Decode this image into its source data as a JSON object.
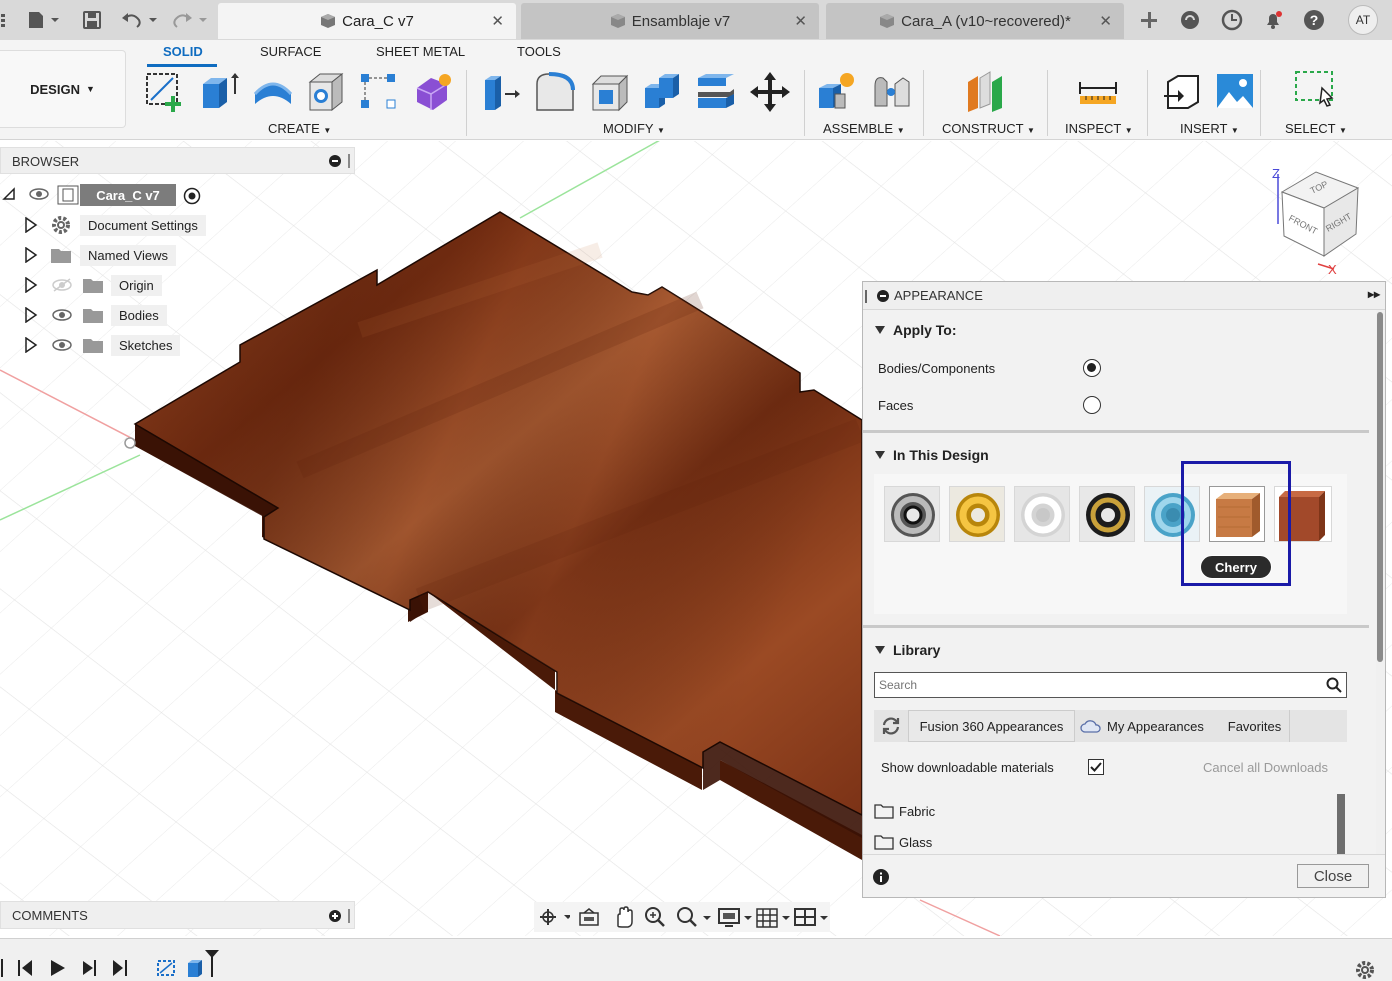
{
  "tabs": [
    {
      "label": "Cara_C v7",
      "active": true
    },
    {
      "label": "Ensamblaje v7",
      "active": false
    },
    {
      "label": "Cara_A (v10~recovered)*",
      "active": false
    }
  ],
  "user": {
    "initials": "AT"
  },
  "toolbar": {
    "design_label": "DESIGN",
    "categories": [
      "SOLID",
      "SURFACE",
      "SHEET METAL",
      "TOOLS"
    ],
    "groups": {
      "create": "CREATE",
      "modify": "MODIFY",
      "assemble": "ASSEMBLE",
      "construct": "CONSTRUCT",
      "inspect": "INSPECT",
      "insert": "INSERT",
      "select": "SELECT"
    }
  },
  "browser": {
    "title": "BROWSER",
    "root": "Cara_C v7",
    "items": [
      {
        "label": "Document Settings",
        "icon": "gear-icon"
      },
      {
        "label": "Named Views",
        "icon": "folder-icon"
      },
      {
        "label": "Origin",
        "icon": "folder-icon"
      },
      {
        "label": "Bodies",
        "icon": "folder-icon"
      },
      {
        "label": "Sketches",
        "icon": "folder-icon"
      }
    ]
  },
  "viewcube": {
    "top": "TOP",
    "front": "FRONT",
    "right": "RIGHT",
    "axis_z": "Z",
    "axis_x": "X"
  },
  "appearance": {
    "title": "APPEARANCE",
    "apply_to": {
      "title": "Apply To:",
      "options": [
        {
          "label": "Bodies/Components",
          "selected": true
        },
        {
          "label": "Faces",
          "selected": false
        }
      ]
    },
    "in_this_design": {
      "title": "In This Design",
      "tooltip": "Cherry",
      "swatches": [
        "chrome",
        "gold",
        "white",
        "dark-gold",
        "glass-blue",
        "cherry",
        "wood"
      ]
    },
    "library": {
      "title": "Library",
      "search_placeholder": "Search",
      "tabs": [
        "Fusion 360 Appearances",
        "My Appearances",
        "Favorites"
      ],
      "show_downloadable": "Show downloadable materials",
      "show_downloadable_checked": true,
      "cancel_downloads": "Cancel all Downloads",
      "folders": [
        "Fabric",
        "Glass"
      ]
    },
    "close_label": "Close"
  },
  "comments": {
    "title": "COMMENTS"
  },
  "colors": {
    "accent": "#0f6cc0",
    "highlight": "#1a1aa8",
    "wood": "#8a3a1c"
  }
}
